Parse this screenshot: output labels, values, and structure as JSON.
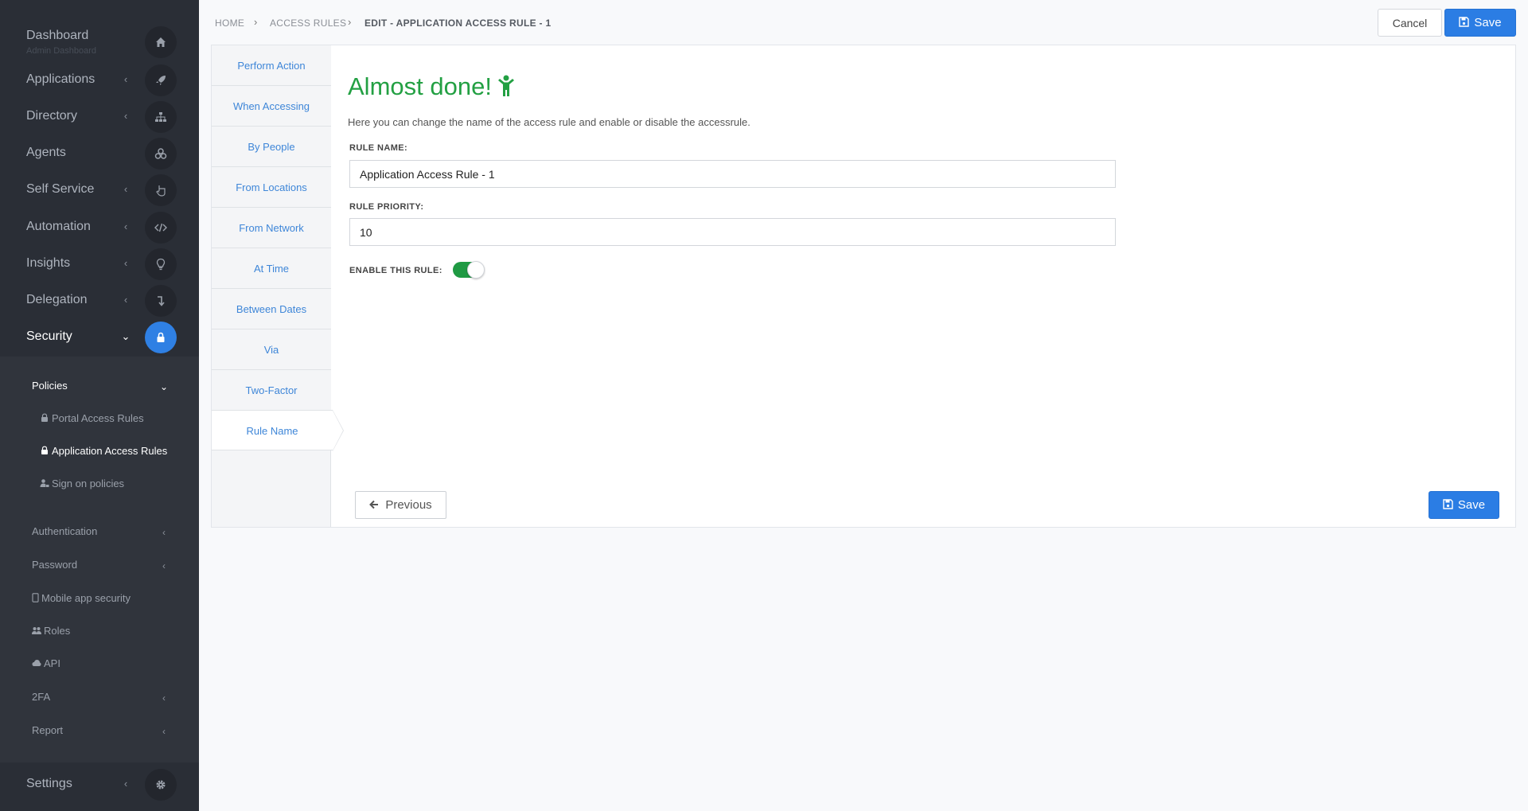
{
  "sidebar": {
    "dashboard": {
      "label": "Dashboard",
      "sub": "Admin Dashboard",
      "icon": "home-icon"
    },
    "items": [
      {
        "label": "Applications",
        "icon": "rocket-icon"
      },
      {
        "label": "Directory",
        "icon": "sitemap-icon"
      },
      {
        "label": "Agents",
        "icon": "cubes-icon"
      },
      {
        "label": "Self Service",
        "icon": "hand-pointer-icon"
      },
      {
        "label": "Automation",
        "icon": "code-icon"
      },
      {
        "label": "Insights",
        "icon": "lightbulb-icon"
      },
      {
        "label": "Delegation",
        "icon": "level-down-icon"
      },
      {
        "label": "Security",
        "icon": "lock-icon"
      }
    ],
    "subnav": {
      "policies": "Policies",
      "portal_access_rules": "Portal Access Rules",
      "application_access_rules": "Application Access Rules",
      "sign_on_policies": "Sign on policies",
      "authentication": "Authentication",
      "password": "Password",
      "mobile_app_security": "Mobile app security",
      "roles": "Roles",
      "api": "API",
      "twofa": "2FA",
      "report": "Report"
    },
    "settings": {
      "label": "Settings",
      "icon": "gear-icon"
    }
  },
  "breadcrumb": {
    "home": "HOME",
    "access_rules": "ACCESS RULES",
    "current": "EDIT - APPLICATION ACCESS RULE - 1"
  },
  "toolbar": {
    "cancel": "Cancel",
    "save": "Save"
  },
  "steps": [
    "Perform Action",
    "When Accessing",
    "By People",
    "From Locations",
    "From Network",
    "At Time",
    "Between Dates",
    "Via",
    "Two-Factor",
    "Rule Name"
  ],
  "active_step": "Rule Name",
  "form": {
    "heading": "Almost done!",
    "description": "Here you can change the name of the access rule and enable or disable the accessrule.",
    "rule_name_label": "RULE NAME:",
    "rule_name_value": "Application Access Rule - 1",
    "rule_priority_label": "RULE PRIORITY:",
    "rule_priority_value": "10",
    "enable_label": "ENABLE THIS RULE:",
    "enabled": true
  },
  "footer": {
    "previous": "Previous",
    "save": "Save"
  },
  "colors": {
    "accent": "#2b7de4",
    "success": "#23a043",
    "sidebar_bg": "#2a2e36"
  }
}
